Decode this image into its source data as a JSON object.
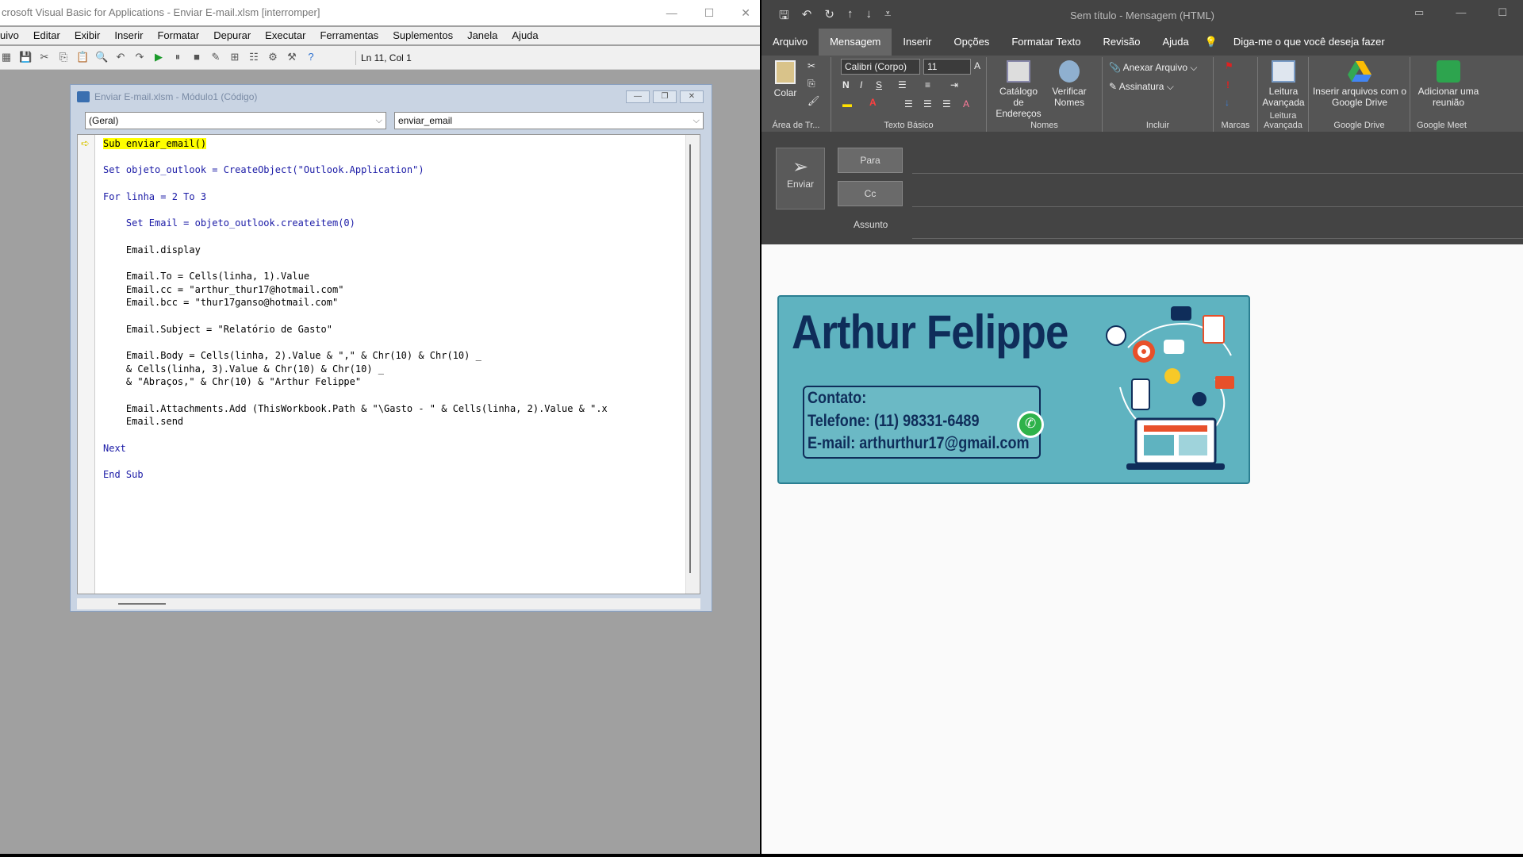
{
  "vba": {
    "title": "crosoft Visual Basic for Applications - Enviar E-mail.xlsm [interromper]",
    "window_controls": [
      "—",
      "☐",
      "✕"
    ],
    "menu": [
      "uivo",
      "Editar",
      "Exibir",
      "Inserir",
      "Formatar",
      "Depurar",
      "Executar",
      "Ferramentas",
      "Suplementos",
      "Janela",
      "Ajuda"
    ],
    "cursor_position": "Ln 11, Col 1",
    "code_window": {
      "title": "Enviar E-mail.xlsm - Módulo1 (Código)",
      "object_combo": "(Geral)",
      "procedure_combo": "enviar_email"
    },
    "code": [
      "Sub enviar_email()",
      "",
      "Set objeto_outlook = CreateObject(\"Outlook.Application\")",
      "",
      "For linha = 2 To 3",
      "",
      "    Set Email = objeto_outlook.createitem(0)",
      "",
      "    Email.display",
      "",
      "    Email.To = Cells(linha, 1).Value",
      "    Email.cc = \"arthur_thur17@hotmail.com\"",
      "    Email.bcc = \"thur17ganso@hotmail.com\"",
      "",
      "    Email.Subject = \"Relatório de Gasto\"",
      "",
      "    Email.Body = Cells(linha, 2).Value & \",\" & Chr(10) & Chr(10) _",
      "    & Cells(linha, 3).Value & Chr(10) & Chr(10) _",
      "    & \"Abraços,\" & Chr(10) & \"Arthur Felippe\"",
      "",
      "    Email.Attachments.Add (ThisWorkbook.Path & \"\\Gasto - \" & Cells(linha, 2).Value & \".x",
      "    Email.send",
      "",
      "Next",
      "",
      "End Sub"
    ]
  },
  "outlook": {
    "title": "Sem título  -  Mensagem (HTML)",
    "tabs": [
      "Arquivo",
      "Mensagem",
      "Inserir",
      "Opções",
      "Formatar Texto",
      "Revisão",
      "Ajuda"
    ],
    "active_tab": "Mensagem",
    "tell_me": "Diga-me o que você deseja fazer",
    "ribbon": {
      "paste": "Colar",
      "clipboard_group": "Área de Tr...",
      "font_name": "Calibri (Corpo)",
      "font_size": "11",
      "basic_text_group": "Texto Básico",
      "address_book": "Catálogo de Endereços",
      "check_names": "Verificar Nomes",
      "names_group": "Nomes",
      "attach_file": "Anexar Arquivo",
      "signature": "Assinatura",
      "include_group": "Incluir",
      "tags_group": "Marcas",
      "immersive_reader": "Leitura Avançada",
      "immersive_group": "Leitura Avançada",
      "insert_drive": "Inserir arquivos com o Google Drive",
      "drive_group": "Google Drive",
      "add_meeting": "Adicionar uma reunião",
      "meet_group": "Google Meet"
    },
    "send": "Enviar",
    "to": "Para",
    "cc": "Cc",
    "subject": "Assunto",
    "signature_banner": {
      "name": "Arthur Felippe",
      "contact_label": "Contato:",
      "phone": "Telefone: (11) 98331-6489",
      "email": "E-mail: arthurthur17@gmail.com"
    }
  }
}
